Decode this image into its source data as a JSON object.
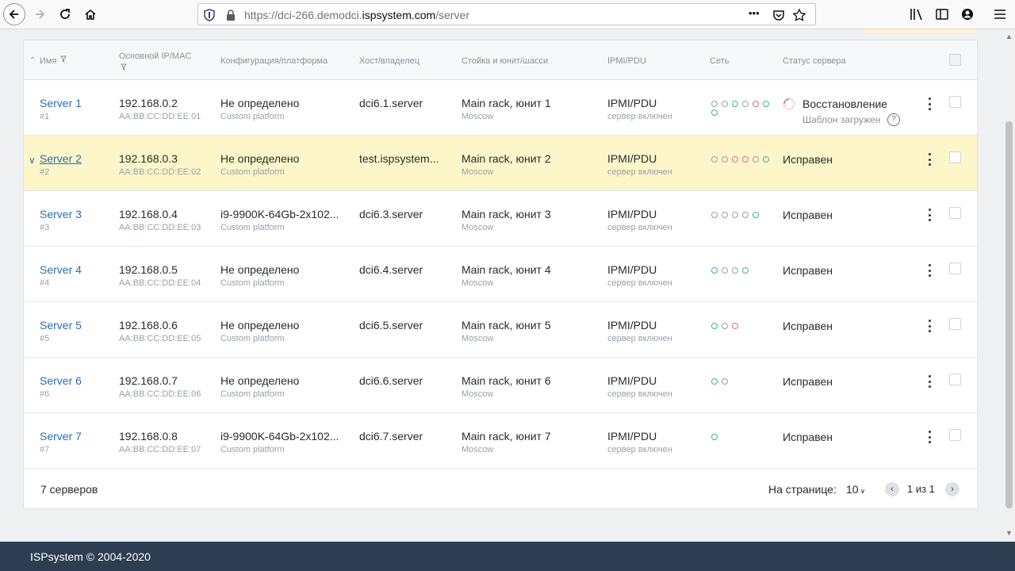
{
  "browser": {
    "url_prefix": "https://dci-266.demodci.",
    "url_domain": "ispsystem.com",
    "url_path": "/server",
    "more_label": "•••"
  },
  "table": {
    "headers": {
      "name": "Имя",
      "ip": "Основной IP/MAC",
      "config": "Конфигурация/платформа",
      "host": "Хост/владелец",
      "rack": "Стойка и юнит/шасси",
      "ipmi": "IPMI/PDU",
      "net": "Сеть",
      "status": "Статус сервера"
    },
    "rows": [
      {
        "name": "Server 1",
        "id": "#1",
        "ip": "192.168.0.2",
        "mac": "AA:BB:CC:DD:EE:01",
        "config": "Не определено",
        "platform": "Custom platform",
        "host": "dci6.1.server",
        "rack": "Main rack, юнит 1",
        "location": "Moscow",
        "ipmi": "IPMI/PDU",
        "ipmi_state": "сервер включен",
        "dots": [
          "g",
          "g",
          "t",
          "g",
          "r",
          "t",
          "t"
        ],
        "status": "Восстановление",
        "status_sub": "Шаблон загружен",
        "help": "?"
      },
      {
        "name": "Server 2",
        "id": "#2",
        "ip": "192.168.0.3",
        "mac": "AA:BB:CC:DD:EE:02",
        "config": "Не определено",
        "platform": "Custom platform",
        "host": "test.ispsystem...",
        "rack": "Main rack, юнит 2",
        "location": "Moscow",
        "ipmi": "IPMI/PDU",
        "ipmi_state": "сервер включен",
        "dots": [
          "g",
          "g",
          "r",
          "r",
          "g",
          "t"
        ],
        "status": "Исправен"
      },
      {
        "name": "Server 3",
        "id": "#3",
        "ip": "192.168.0.4",
        "mac": "AA:BB:CC:DD:EE:03",
        "config": "i9-9900K-64Gb-2x102...",
        "platform": "Custom platform",
        "host": "dci6.3.server",
        "rack": "Main rack, юнит 3",
        "location": "Moscow",
        "ipmi": "IPMI/PDU",
        "ipmi_state": "сервер включен",
        "dots": [
          "g",
          "g",
          "g",
          "g",
          "t"
        ],
        "status": "Исправен"
      },
      {
        "name": "Server 4",
        "id": "#4",
        "ip": "192.168.0.5",
        "mac": "AA:BB:CC:DD:EE:04",
        "config": "Не определено",
        "platform": "Custom platform",
        "host": "dci6.4.server",
        "rack": "Main rack, юнит 4",
        "location": "Moscow",
        "ipmi": "IPMI/PDU",
        "ipmi_state": "сервер включен",
        "dots": [
          "t",
          "g",
          "g",
          "t"
        ],
        "status": "Исправен"
      },
      {
        "name": "Server 5",
        "id": "#5",
        "ip": "192.168.0.6",
        "mac": "AA:BB:CC:DD:EE:05",
        "config": "Не определено",
        "platform": "Custom platform",
        "host": "dci6.5.server",
        "rack": "Main rack, юнит 5",
        "location": "Moscow",
        "ipmi": "IPMI/PDU",
        "ipmi_state": "сервер включен",
        "dots": [
          "t",
          "g",
          "r"
        ],
        "status": "Исправен"
      },
      {
        "name": "Server 6",
        "id": "#6",
        "ip": "192.168.0.7",
        "mac": "AA:BB:CC:DD:EE:06",
        "config": "Не определено",
        "platform": "Custom platform",
        "host": "dci6.6.server",
        "rack": "Main rack, юнит 6",
        "location": "Moscow",
        "ipmi": "IPMI/PDU",
        "ipmi_state": "сервер включен",
        "dots": [
          "t",
          "g"
        ],
        "status": "Исправен"
      },
      {
        "name": "Server 7",
        "id": "#7",
        "ip": "192.168.0.8",
        "mac": "AA:BB:CC:DD:EE:07",
        "config": "i9-9900K-64Gb-2x102...",
        "platform": "Custom platform",
        "host": "dci6.7.server",
        "rack": "Main rack, юнит 7",
        "location": "Moscow",
        "ipmi": "IPMI/PDU",
        "ipmi_state": "сервер включен",
        "dots": [
          "t"
        ],
        "status": "Исправен"
      }
    ],
    "selected_row": 1
  },
  "pagination": {
    "total": "7 серверов",
    "per_page_label": "На странице:",
    "per_page_value": "10",
    "page_info": "1 из 1"
  },
  "footer": {
    "copyright": "ISPsystem © 2004-2020"
  },
  "colors": {
    "link": "#2a6db0",
    "selected_row": "#fdf6c8",
    "footer_bg": "#2e3e52",
    "dot_teal": "#32b6a8",
    "dot_pink": "#e26a8a",
    "dot_gray": "#9aa0a8"
  }
}
